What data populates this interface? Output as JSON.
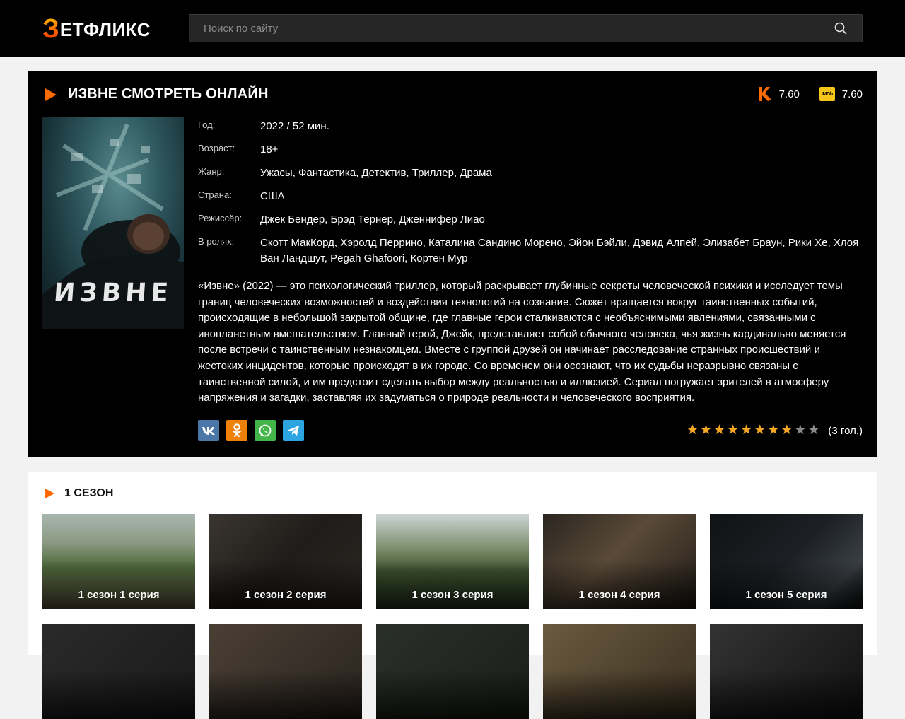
{
  "header": {
    "logo_first": "З",
    "logo_rest": "ЕТФЛИКС",
    "search_placeholder": "Поиск по сайту"
  },
  "movie": {
    "title": "ИЗВНЕ СМОТРЕТЬ ОНЛАЙН",
    "rating_kp": "7.60",
    "rating_imdb": "7.60",
    "imdb_badge": "IMDb",
    "poster_word": "ИЗВНЕ",
    "info": [
      {
        "label": "Год:",
        "value": "2022 / 52 мин."
      },
      {
        "label": "Возраст:",
        "value": "18+"
      },
      {
        "label": "Жанр:",
        "value": "Ужасы, Фантастика, Детектив, Триллер, Драма"
      },
      {
        "label": "Страна:",
        "value": "США"
      },
      {
        "label": "Режиссёр:",
        "value": "Джек Бендер, Брэд Тернер, Дженнифер Лиао"
      },
      {
        "label": "В ролях:",
        "value": "Скотт МакКорд, Хэролд Перрино, Каталина Сандино Морено, Эйон Бэйли, Дэвид Алпей, Элизабет Браун, Рики Хе, Хлоя Ван Ландшут, Pegah Ghafoori, Кортен Мур"
      }
    ],
    "description": "«Извне» (2022) — это психологический триллер, который раскрывает глубинные секреты человеческой психики и исследует темы границ человеческих возможностей и воздействия технологий на сознание. Сюжет вращается вокруг таинственных событий, происходящие в небольшой закрытой общине, где главные герои сталкиваются с необъяснимыми явлениями, связанными с инопланетным вмешательством. Главный герой, Джейк, представляет собой обычного человека, чья жизнь кардинально меняется после встречи с таинственным незнакомцем. Вместе с группой друзей он начинает расследование странных происшествий и жестоких инцидентов, которые происходят в их городе. Со временем они осознают, что их судьбы неразрывно связаны с таинственной силой, и им предстоит сделать выбор между реальностью и иллюзией. Сериал погружает зрителей в атмосферу напряжения и загадки, заставляя их задуматься о природе реальности и человеческого восприятия.",
    "user_rating": 8,
    "user_rating_max": 10,
    "votes": "(3 гол.)",
    "share": [
      {
        "name": "vk",
        "label": "VK"
      },
      {
        "name": "ok",
        "label": "OK"
      },
      {
        "name": "whatsapp",
        "label": "WA"
      },
      {
        "name": "telegram",
        "label": "TG"
      }
    ]
  },
  "season": {
    "title": "1 СЕЗОН",
    "episodes": [
      "1 сезон 1 серия",
      "1 сезон 2 серия",
      "1 сезон 3 серия",
      "1 сезон 4 серия",
      "1 сезон 5 серия",
      "",
      "",
      "",
      "",
      ""
    ]
  },
  "colors": {
    "accent": "#ff6a00",
    "star_on": "#f5a623",
    "imdb": "#f5c518"
  }
}
